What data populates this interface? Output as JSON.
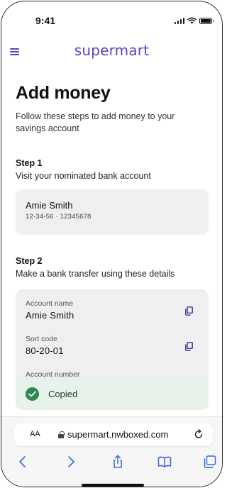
{
  "status_bar": {
    "time": "9:41"
  },
  "app": {
    "brand": "supermart",
    "brand_color": "#5b43c4"
  },
  "page": {
    "title": "Add money",
    "lead": "Follow these steps to add money to your savings account"
  },
  "step1": {
    "title": "Step 1",
    "description": "Visit your nominated bank account",
    "account": {
      "name": "Amie Smith",
      "number": "12-34-56 · 12345678"
    }
  },
  "step2": {
    "title": "Step 2",
    "description": "Make a bank transfer using these details",
    "fields": [
      {
        "label": "Account name",
        "value": "Amie Smith"
      },
      {
        "label": "Sort code",
        "value": "80-20-01"
      },
      {
        "label": "Account number",
        "value": ""
      }
    ]
  },
  "toast": {
    "message": "Copied",
    "color": "#2e8a4e"
  },
  "browser": {
    "text_size_label": "AA",
    "url": "supermart.nwboxed.com"
  },
  "icons": {
    "menu": "hamburger-icon",
    "copy": "copy-icon",
    "check": "check-circle-icon",
    "lock": "lock-icon",
    "reload": "reload-icon",
    "back": "chevron-left-icon",
    "forward": "chevron-right-icon",
    "share": "share-icon",
    "bookmarks": "book-icon",
    "tabs": "tabs-icon"
  }
}
